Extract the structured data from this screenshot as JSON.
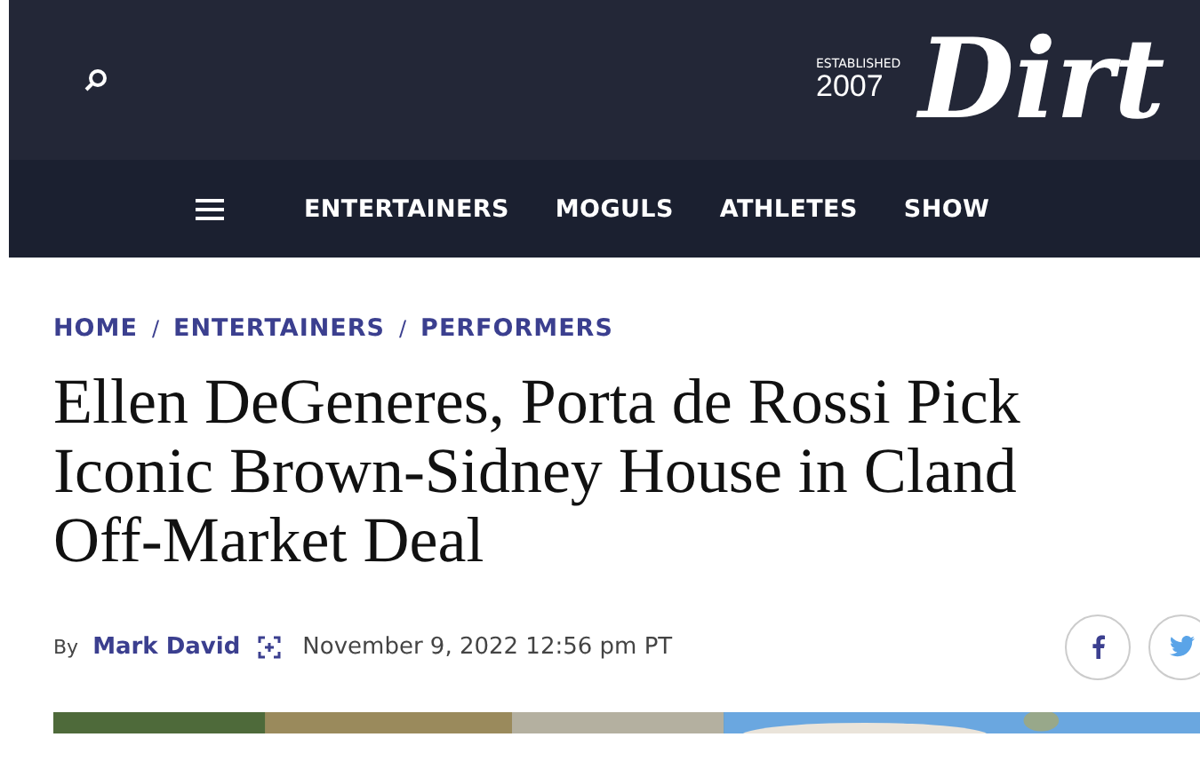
{
  "header": {
    "established_label": "ESTABLISHED",
    "established_year": "2007",
    "logo": "Dirt"
  },
  "nav": {
    "items": [
      {
        "label": "ENTERTAINERS"
      },
      {
        "label": "MOGULS"
      },
      {
        "label": "ATHLETES"
      },
      {
        "label": "SHOW"
      }
    ]
  },
  "breadcrumb": [
    "HOME",
    "ENTERTAINERS",
    "PERFORMERS"
  ],
  "breadcrumb_separator": "/",
  "title_lines": [
    "Ellen DeGeneres, Porta de Rossi Pick",
    "Iconic Brown-Sidney House in Cland",
    "Off-Market Deal"
  ],
  "byline": {
    "prefix": "By",
    "author": "Mark David",
    "date": "November 9, 2022 12:56 pm PT"
  },
  "hero": {
    "kind": "picture"
  }
}
